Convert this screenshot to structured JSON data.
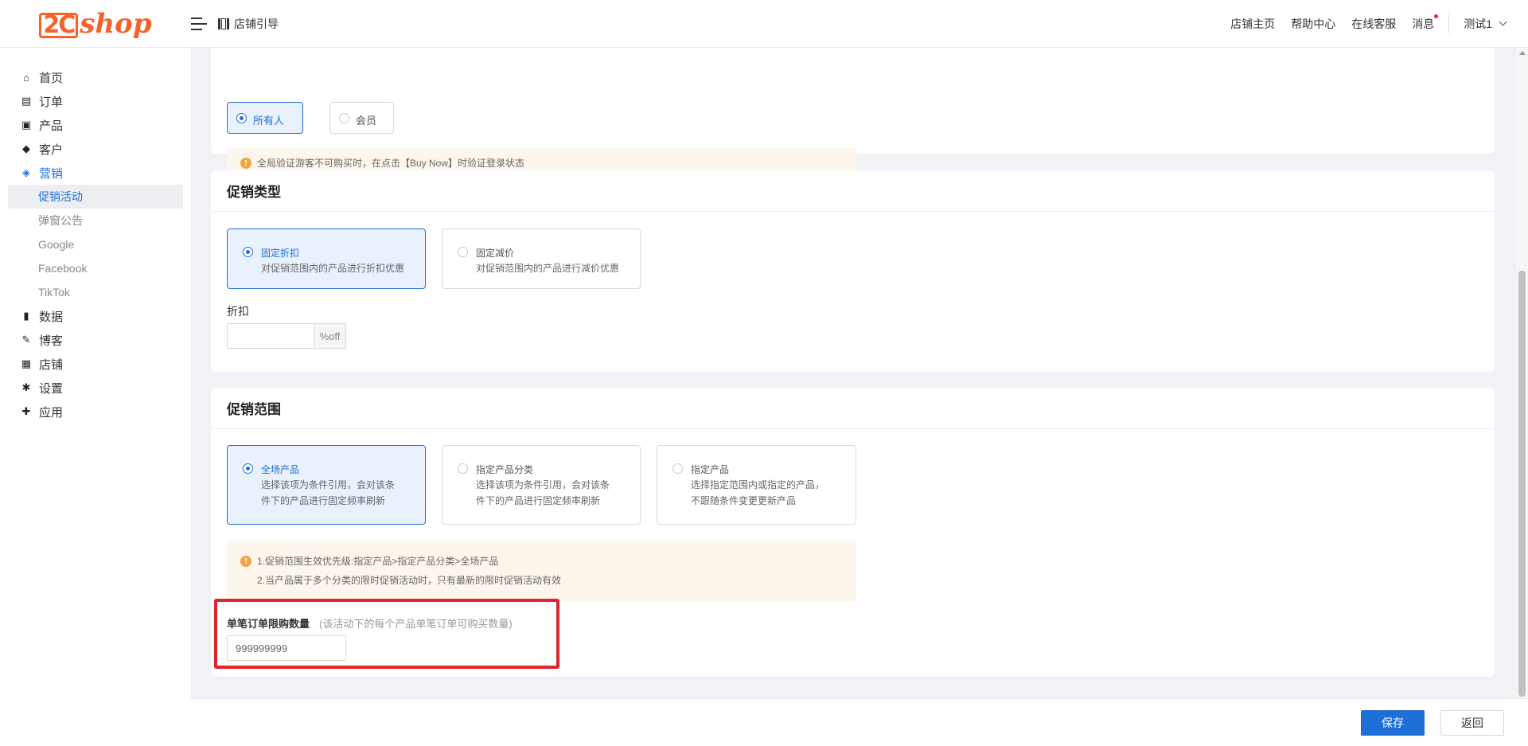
{
  "header": {
    "logo_mark": "2C",
    "logo_text": "shop",
    "guide_label": "店铺引导",
    "nav": [
      "店铺主页",
      "帮助中心",
      "在线客服",
      "消息"
    ],
    "user": "测试1"
  },
  "sidebar": {
    "items": [
      {
        "label": "首页",
        "icon": "home-icon",
        "glyph": "⌂"
      },
      {
        "label": "订单",
        "icon": "clipboard-icon",
        "glyph": "▤"
      },
      {
        "label": "产品",
        "icon": "bag-icon",
        "glyph": "▣"
      },
      {
        "label": "客户",
        "icon": "diamond-icon",
        "glyph": "◆"
      },
      {
        "label": "营销",
        "icon": "tag-icon",
        "glyph": "◈"
      },
      {
        "label": "数据",
        "icon": "bar-chart-icon",
        "glyph": "▮"
      },
      {
        "label": "博客",
        "icon": "edit-icon",
        "glyph": "✎"
      },
      {
        "label": "店铺",
        "icon": "store-icon",
        "glyph": "▦"
      },
      {
        "label": "设置",
        "icon": "gear-icon",
        "glyph": "✱"
      },
      {
        "label": "应用",
        "icon": "puzzle-icon",
        "glyph": "✚"
      }
    ],
    "marketing_sub": [
      "促销活动",
      "弹窗公告",
      "Google",
      "Facebook",
      "TikTok"
    ]
  },
  "audience": {
    "options": [
      "所有人",
      "会员"
    ],
    "selected": "所有人",
    "notice": "全局验证游客不可购买时，在点击【Buy Now】时验证登录状态"
  },
  "promo_type": {
    "title": "促销类型",
    "options": [
      {
        "label": "固定折扣",
        "desc": "对促销范围内的产品进行折扣优惠"
      },
      {
        "label": "固定减价",
        "desc": "对促销范围内的产品进行减价优惠"
      }
    ],
    "selected": "固定折扣",
    "discount_label": "折扣",
    "discount_value": "",
    "discount_suffix": "%off"
  },
  "promo_scope": {
    "title": "促销范围",
    "options": [
      {
        "label": "全场产品",
        "desc1": "选择该项为条件引用，会对该条",
        "desc2": "件下的产品进行固定频率刷新"
      },
      {
        "label": "指定产品分类",
        "desc1": "选择该项为条件引用，会对该条",
        "desc2": "件下的产品进行固定频率刷新"
      },
      {
        "label": "指定产品",
        "desc1": "选择指定范围内或指定的产品，",
        "desc2": "不跟随条件变更更新产品"
      }
    ],
    "selected": "全场产品",
    "notice1": "1.促销范围生效优先级:指定产品>指定产品分类>全场产品",
    "notice2": "2.当产品属于多个分类的限时促销活动时，只有最新的限时促销活动有效",
    "limit_label": "单笔订单限购数量",
    "limit_hint": "(该活动下的每个产品单笔订单可购买数量)",
    "limit_value": "999999999"
  },
  "footer": {
    "save": "保存",
    "back": "返回"
  },
  "colors": {
    "brand": "#f5622a",
    "primary": "#1f6fd9",
    "highlight": "#e0242a",
    "notice_bg": "#fdf6ec",
    "warn": "#f0a640"
  }
}
